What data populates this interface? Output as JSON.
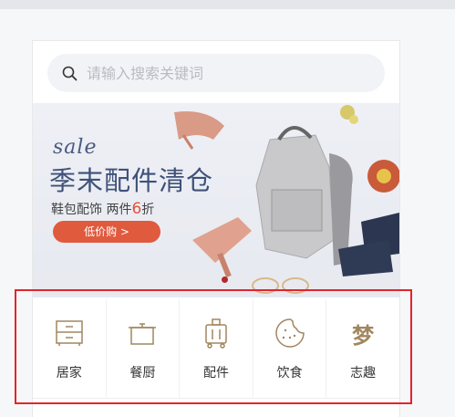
{
  "search": {
    "placeholder": "请输入搜索关键词",
    "icon": "search-icon"
  },
  "banner": {
    "sale": "sale",
    "title": "季末配件清仓",
    "subtitle_pre": "鞋包配饰 两件",
    "subtitle_num": "6",
    "subtitle_post": "折",
    "cta": "低价购 >",
    "accent_color": "#e05a3e"
  },
  "categories": [
    {
      "label": "居家",
      "icon": "cabinet-icon"
    },
    {
      "label": "餐厨",
      "icon": "pot-icon"
    },
    {
      "label": "配件",
      "icon": "luggage-icon"
    },
    {
      "label": "饮食",
      "icon": "cookie-icon"
    },
    {
      "label": "志趣",
      "icon": "hobby-glyph-icon",
      "glyph": "梦"
    }
  ],
  "colors": {
    "highlight": "#e3242b",
    "icon": "#a0865f"
  }
}
